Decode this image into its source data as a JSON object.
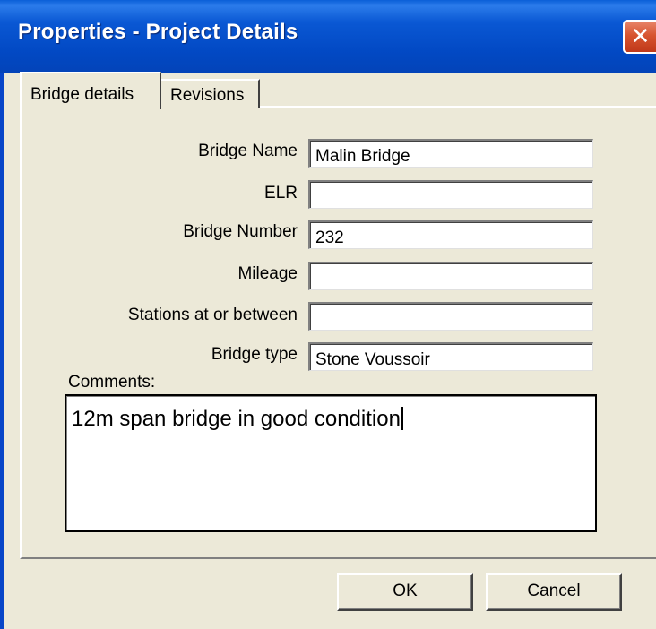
{
  "window": {
    "title": "Properties - Project Details",
    "close_glyph": "✕"
  },
  "tabs": [
    {
      "label": "Bridge details",
      "active": true
    },
    {
      "label": "Revisions",
      "active": false
    }
  ],
  "fields": {
    "bridge_name": {
      "label": "Bridge Name",
      "value": "Malin Bridge"
    },
    "elr": {
      "label": "ELR",
      "value": ""
    },
    "bridge_number": {
      "label": "Bridge Number",
      "value": "232"
    },
    "mileage": {
      "label": "Mileage",
      "value": ""
    },
    "stations": {
      "label": "Stations at or between",
      "value": ""
    },
    "bridge_type": {
      "label": "Bridge type",
      "value": "Stone Voussoir"
    }
  },
  "comments": {
    "label": "Comments:",
    "value": "12m span bridge in good condition"
  },
  "buttons": {
    "ok_label": "OK",
    "cancel_label": "Cancel"
  },
  "colors": {
    "titlebar": "#0a58d4",
    "close_button": "#d7542f",
    "dialog_background": "#ece9d8"
  }
}
